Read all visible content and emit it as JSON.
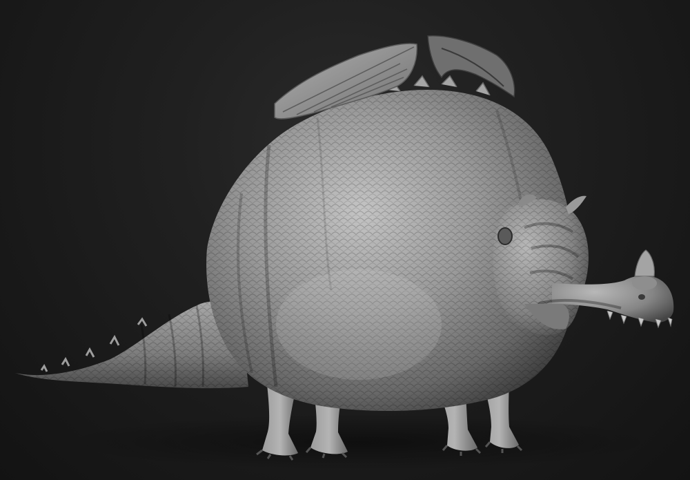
{
  "scene": {
    "subject_icon": "dragon-sculpt",
    "colors": {
      "background_top": "#2a2a2a",
      "background_bottom": "#131313",
      "clay_light": "#bdbdbd",
      "clay_mid": "#8c8c8c",
      "clay_dark": "#3c3c3c"
    }
  }
}
